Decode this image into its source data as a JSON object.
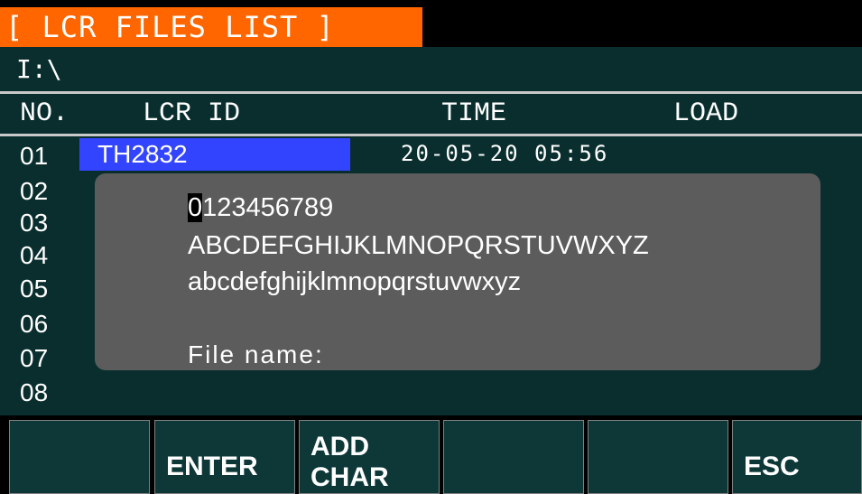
{
  "window": {
    "title": "[ LCR FILES LIST ]"
  },
  "path": "I:\\",
  "columns": {
    "no": "NO.",
    "lcr_id": "LCR ID",
    "time": "TIME",
    "load": "LOAD"
  },
  "rows": [
    {
      "no": "01",
      "lcr_id": "TH2832",
      "time": "20-05-20 05:56"
    },
    {
      "no": "02"
    },
    {
      "no": "03"
    },
    {
      "no": "04"
    },
    {
      "no": "05"
    },
    {
      "no": "06"
    },
    {
      "no": "07"
    },
    {
      "no": "08"
    }
  ],
  "char_dialog": {
    "cursor_char": "0",
    "digits_rest": "123456789",
    "uppercase": "ABCDEFGHIJKLMNOPQRSTUVWXYZ",
    "lowercase": "abcdefghijklmnopqrstuvwxyz",
    "file_name_label": "File name:"
  },
  "softkeys": {
    "enter": "ENTER",
    "add_char_line1": "ADD",
    "add_char_line2": "CHAR",
    "esc": "ESC"
  },
  "colors": {
    "title_bg": "#ff6600",
    "selection": "#3344ff",
    "background": "#0a2e2e",
    "dialog": "#5c5c5c"
  }
}
